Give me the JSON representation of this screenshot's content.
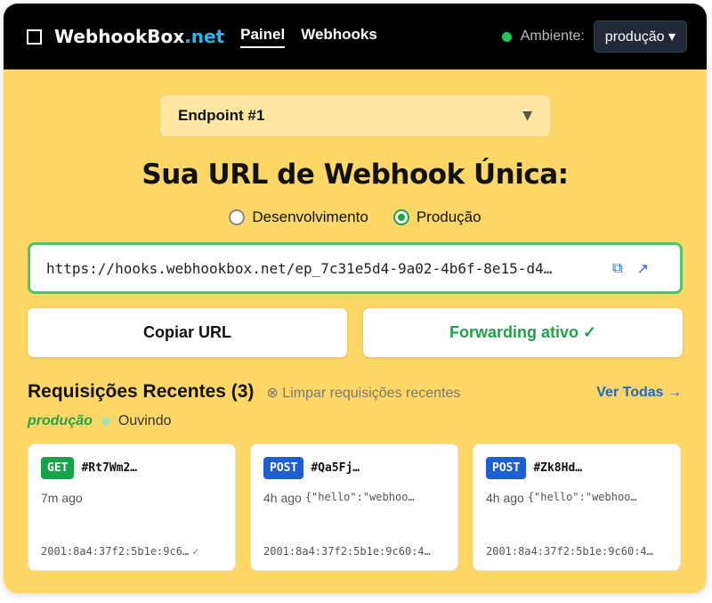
{
  "header": {
    "brand_main": "WebhookBox",
    "brand_tld": ".net",
    "nav": [
      {
        "label": "Painel",
        "active": true
      },
      {
        "label": "Webhooks",
        "active": false
      }
    ],
    "env_label": "Ambiente:",
    "env_value": "produção ▾"
  },
  "endpoint": {
    "selected": "Endpoint #1",
    "arrow": "▼"
  },
  "headline": "Sua URL de Webhook Única:",
  "modes": [
    {
      "label": "Desenvolvimento",
      "checked": false
    },
    {
      "label": "Produção",
      "checked": true
    }
  ],
  "url": "https://hooks.webhookbox.net/ep_7c31e5d4-9a02-4b6f-8e15-d4…",
  "buttons": {
    "copy": "Copiar URL",
    "forwarding": "Forwarding ativo ✓"
  },
  "requests": {
    "title": "Requisições Recentes (3)",
    "clear": "⊗ Limpar requisições recentes",
    "see_all": "Ver Todas →",
    "env": "produção",
    "listening": "Ouvindo",
    "items": [
      {
        "method": "GET",
        "id": "#Rt7Wm2…",
        "time": "7m ago",
        "body": "",
        "ip": "2001:8a4:37f2:5b1e:9c6…",
        "ok": "✓"
      },
      {
        "method": "POST",
        "id": "#Qa5Fj…",
        "time": "4h ago",
        "body": "{\"hello\":\"webhoo…",
        "ip": "2001:8a4:37f2:5b1e:9c60:4…",
        "ok": ""
      },
      {
        "method": "POST",
        "id": "#Zk8Hd…",
        "time": "4h ago",
        "body": "{\"hello\":\"webhoo…",
        "ip": "2001:8a4:37f2:5b1e:9c60:4…",
        "ok": ""
      }
    ]
  }
}
